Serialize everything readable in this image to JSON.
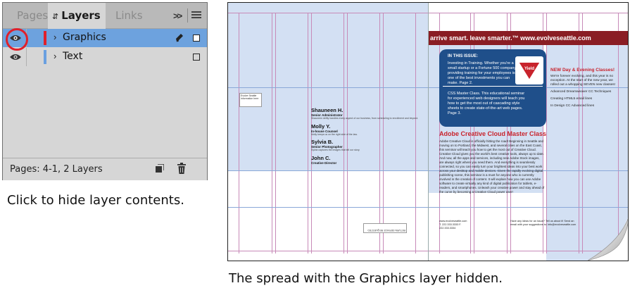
{
  "panel": {
    "tabs": [
      {
        "label": "Pages",
        "active": false
      },
      {
        "label": "Layers",
        "active": true
      },
      {
        "label": "Links",
        "active": false
      }
    ],
    "collapse_icon": ">>",
    "menu_icon": "hamburger-icon",
    "layers": [
      {
        "name": "Graphics",
        "color": "#e0202a",
        "selected": true,
        "visible": true,
        "editable_icon": "pen-icon"
      },
      {
        "name": "Text",
        "color": "#6aa0e0",
        "selected": false,
        "visible": true
      }
    ],
    "status": "Pages: 4-1, 2 Layers"
  },
  "colors": {
    "selection": "#6da2de",
    "highlight_ring": "#e0202a",
    "accent_red": "#c8232c",
    "banner": "#8a1d24",
    "info_box": "#1f4f8a"
  },
  "captions": {
    "panel": "Click to hide layer contents.",
    "spread": "The spread with the Graphics layer hidden."
  },
  "spread": {
    "banner": "arrive smart. leave smarter.™ www.evolveseattle.com",
    "info_box": {
      "heading": "IN THIS ISSUE:",
      "intro": "Investing in Training. Whether you're a small startup or a Fortune 500 company, providing training for your employees is one of the best investments you can make. Page 2.",
      "css": "CSS Master Class. This educational seminar for experienced web designers will teach you how to get the most out of cascading style sheets to create state-of-the-art web pages. Page 3.",
      "badge": "Yield"
    },
    "sidebar": {
      "title": "NEW Day & Evening Classes!",
      "intro": "We're forever evolving, and this year is no exception. At the start of the new year, we rolled out a whopping SEVEN new classes!",
      "bullets": [
        "Advanced Dreamweaver CC Techniques",
        "Creating HTML5 email lines",
        "In Design CC Advanced lines"
      ]
    },
    "master": {
      "title": "Adobe Creative Cloud Master Class",
      "body": "Adobe Creative Cloud is officially hitting the road! Beginning in Seattle and moving on to Portland, the Midwest, and several cities on the East Coast, this seminar will teach you how to get the most out of Creative Cloud. Creative Cloud gives you the world's best creative tools, always up to date. And now, all the apps and services, including new Adobe Stock images, are always right where you need them. And everything is seamlessly connected, so you can easily turn your brightest ideas into your best work across your desktop and mobile devices. Given the rapidly evolving digital publishing scene, this seminar is a must for anyone who is currently involved in the creation of content. It will explain how you can use Adobe software to create virtually any kind of digital publication for tablets, e-readers, and smartphones. Unleash your creative power and stay ahead of the curve by becoming a Creative Cloud power user!"
    },
    "staff": [
      {
        "name": "Shauneen H.",
        "role": "Senior Administrator",
        "desc": "Shauneen deftly handles every aspect of our business, from scheduling to enrollment and beyond."
      },
      {
        "name": "Molly Y.",
        "role": "In-house Counsel",
        "desc": "Molly keeps us on the right side of the law."
      },
      {
        "name": "Sylvia B.",
        "role": "Senior Photographer",
        "desc": "Sylvia captures the images that tell our story."
      },
      {
        "name": "John C.",
        "role": "Creative Director",
        "desc": ""
      }
    ],
    "small_box": "Evolve Seattle information here",
    "return_stamp": "RETURN SERVICE REQUESTED",
    "footer_left": "www.evolveseattle.com T. 222.333.3333 F. 222.333.3334",
    "footer_right": "Have any ideas for an issue? Tell us about it! Send an email with your suggestions to: info@evolveseattle.com"
  }
}
